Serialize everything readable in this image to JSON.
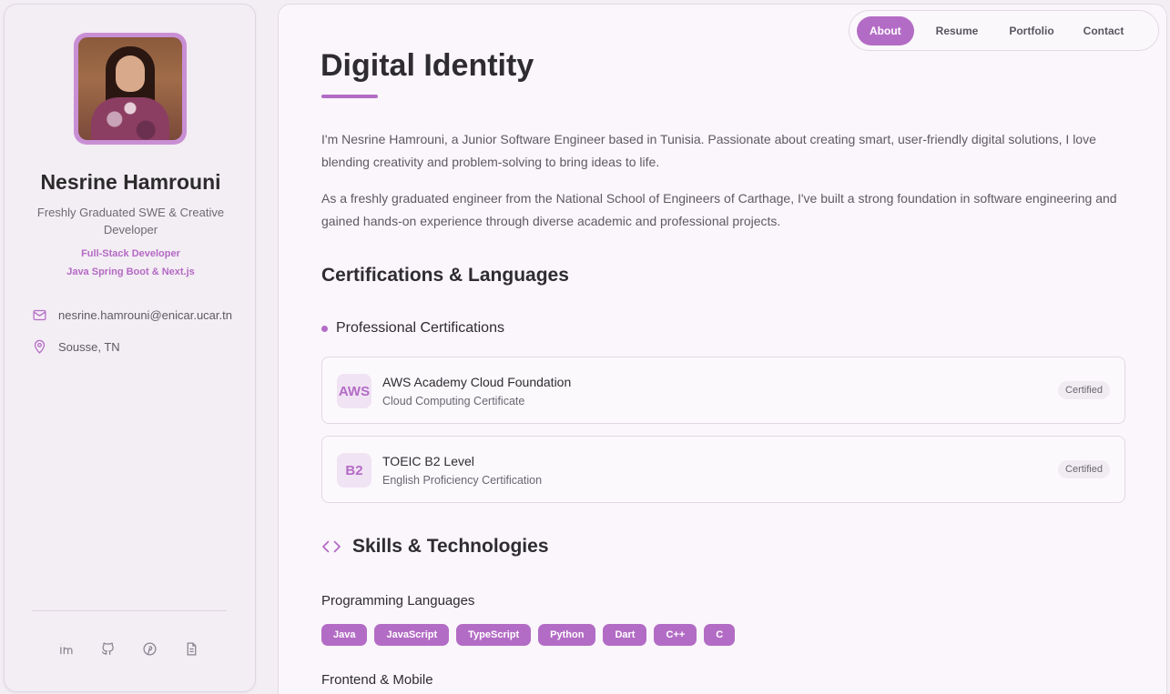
{
  "profile": {
    "name": "Nesrine Hamrouni",
    "title": "Freshly Graduated SWE & Creative Developer",
    "role_primary": "Full-Stack Developer",
    "role_secondary": "Java Spring Boot & Next.js",
    "email": "nesrine.hamrouni@enicar.ucar.tn",
    "location": "Sousse, TN",
    "socials": [
      "linkedin-icon",
      "github-icon",
      "pinterest-icon",
      "document-icon"
    ]
  },
  "nav": {
    "tabs": [
      "About",
      "Resume",
      "Portfolio",
      "Contact"
    ],
    "active": "About"
  },
  "about": {
    "title": "Digital Identity",
    "paragraph_1": "I'm Nesrine Hamrouni, a Junior Software Engineer based in Tunisia. Passionate about creating smart, user-friendly digital solutions, I love blending creativity and problem-solving to bring ideas to life.",
    "paragraph_2": "As a freshly graduated engineer from the National School of Engineers of Carthage, I've built a strong foundation in software engineering and gained hands-on experience through diverse academic and professional projects."
  },
  "certifications": {
    "heading": "Certifications & Languages",
    "subheading": "Professional Certifications",
    "items": [
      {
        "badge": "AWS",
        "name": "AWS Academy Cloud Foundation",
        "subtitle": "Cloud Computing Certificate",
        "status": "Certified"
      },
      {
        "badge": "B2",
        "name": "TOEIC B2 Level",
        "subtitle": "English Proficiency Certification",
        "status": "Certified"
      }
    ]
  },
  "skills": {
    "heading": "Skills & Technologies",
    "groups": [
      {
        "name": "Programming Languages",
        "tags": [
          "Java",
          "JavaScript",
          "TypeScript",
          "Python",
          "Dart",
          "C++",
          "C"
        ]
      },
      {
        "name": "Frontend & Mobile"
      }
    ]
  },
  "colors": {
    "accent": "#b36cc5",
    "background": "#faf6fb",
    "sidebar": "#f3edf4"
  }
}
